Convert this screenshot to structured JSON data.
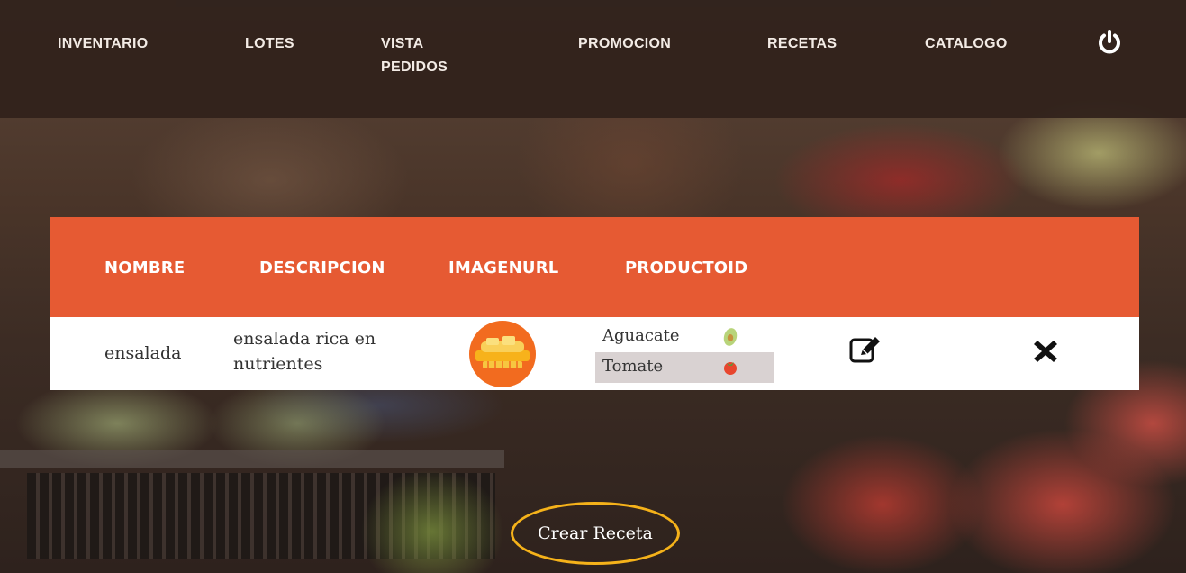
{
  "nav": {
    "items": [
      {
        "label": "INVENTARIO"
      },
      {
        "label": "LOTES"
      },
      {
        "label": "VISTA PEDIDOS"
      },
      {
        "label": "PROMOCION"
      },
      {
        "label": "RECETAS"
      },
      {
        "label": "CATALOGO"
      }
    ],
    "power_icon": "power-icon"
  },
  "table": {
    "headers": [
      "NOMBRE",
      "DESCRIPCION",
      "IMAGENURL",
      "PRODUCTOID"
    ],
    "rows": [
      {
        "nombre": "ensalada",
        "descripcion": "ensalada rica en nutrientes",
        "image_icon": "salad-plate-icon",
        "productos": [
          {
            "name": "Aguacate",
            "icon": "avocado-icon",
            "selected": false
          },
          {
            "name": "Tomate",
            "icon": "tomato-icon",
            "selected": true
          }
        ],
        "edit_icon": "edit-icon",
        "delete_icon": "close-icon"
      }
    ]
  },
  "actions": {
    "create_label": "Crear Receta"
  },
  "colors": {
    "header_bg": "#e65a33",
    "nav_bg": "#30211b",
    "highlight_ring": "#f5b21a",
    "selected_row": "#d9d2d2"
  }
}
